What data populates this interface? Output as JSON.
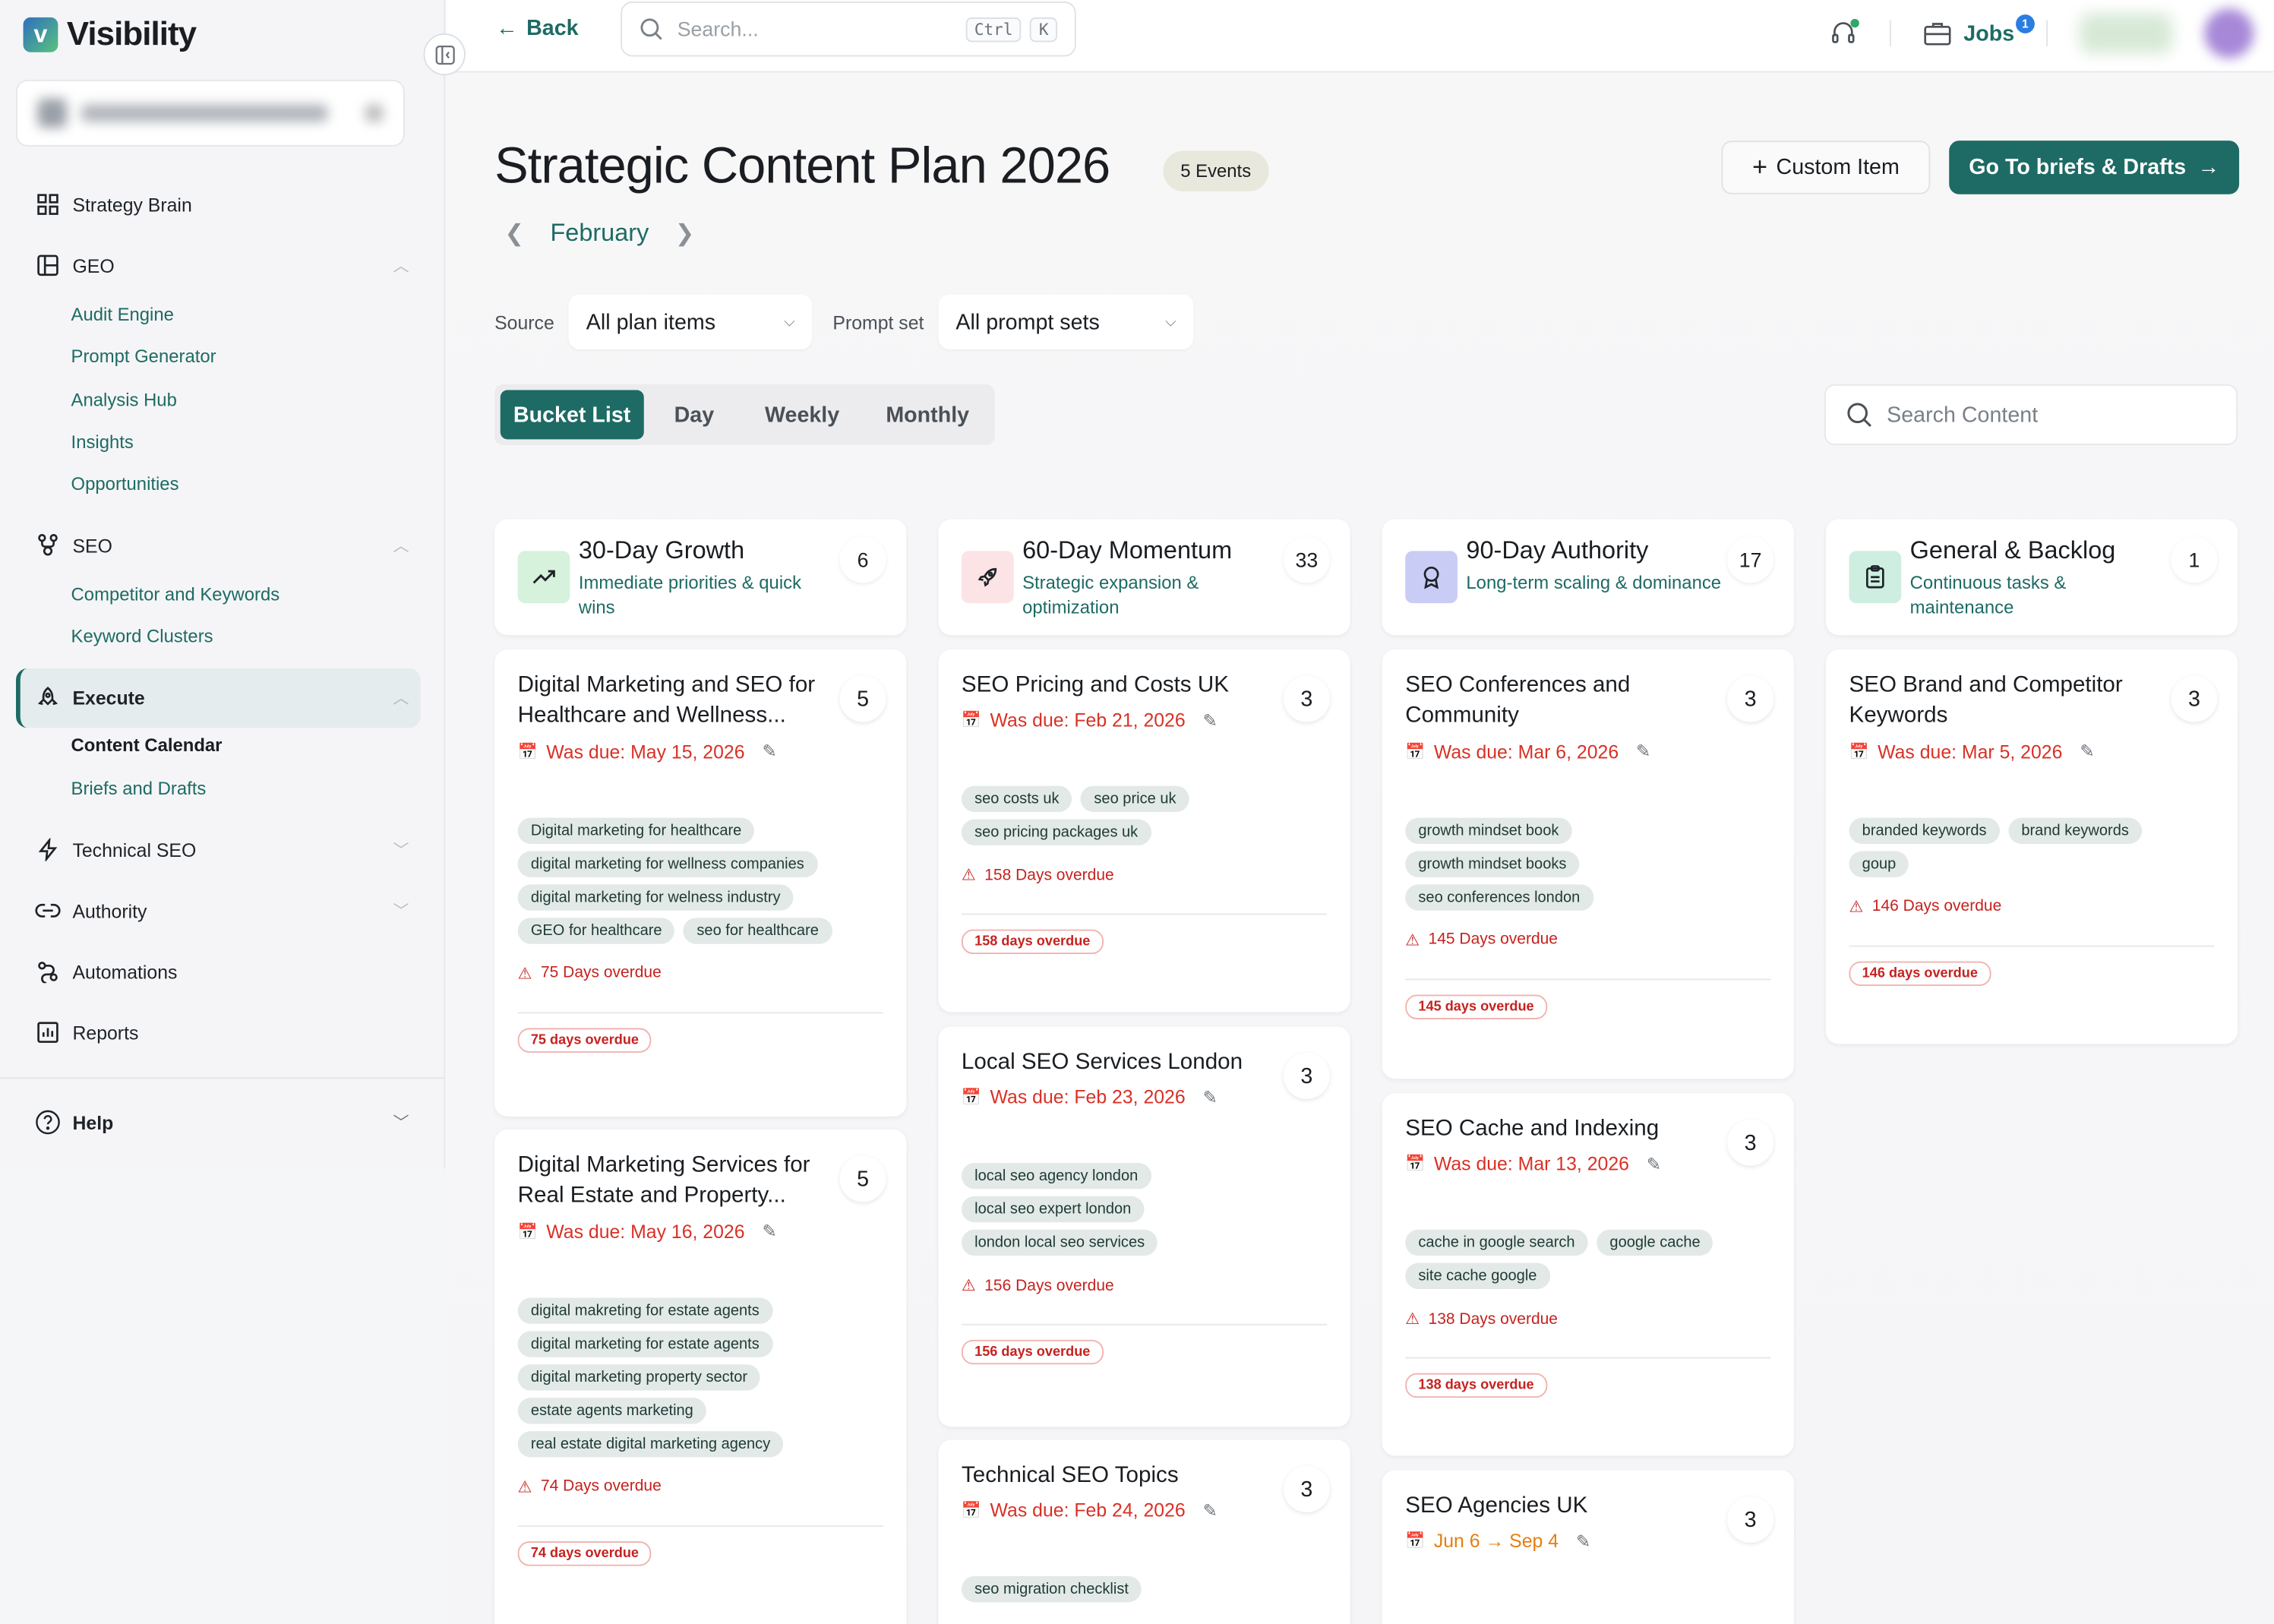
{
  "app": {
    "name": "Visibility",
    "logo_letter": "v"
  },
  "sidebar": {
    "items": [
      {
        "label": "Strategy Brain",
        "icon": "grid-icon"
      },
      {
        "label": "GEO",
        "icon": "layout-icon",
        "sub": [
          "Audit Engine",
          "Prompt Generator",
          "Analysis Hub",
          "Insights",
          "Opportunities"
        ]
      },
      {
        "label": "SEO",
        "icon": "network-icon",
        "sub": [
          "Competitor and Keywords",
          "Keyword Clusters"
        ]
      },
      {
        "label": "Execute",
        "icon": "rocket-icon",
        "sub": [
          "Content Calendar",
          "Briefs and Drafts"
        ]
      },
      {
        "label": "Technical SEO",
        "icon": "bolt-icon"
      },
      {
        "label": "Authority",
        "icon": "link-icon"
      },
      {
        "label": "Automations",
        "icon": "automation-icon"
      },
      {
        "label": "Reports",
        "icon": "chart-icon"
      }
    ],
    "help": "Help"
  },
  "topbar": {
    "back": "Back",
    "search_placeholder": "Search...",
    "kbd_1": "Ctrl",
    "kbd_2": "K",
    "jobs": "Jobs",
    "jobs_badge": "1"
  },
  "header": {
    "title": "Strategic Content Plan 2026",
    "events": "5 Events",
    "month": "February",
    "custom_item": "Custom Item",
    "go_button": "Go To briefs & Drafts"
  },
  "filters": {
    "source_label": "Source",
    "source_value": "All plan items",
    "prompt_label": "Prompt set",
    "prompt_value": "All prompt sets"
  },
  "view_tabs": [
    "Bucket List",
    "Day",
    "Weekly",
    "Monthly"
  ],
  "search_content_placeholder": "Search Content",
  "columns": [
    {
      "title": "30-Day Growth",
      "subtitle": "Immediate priorities & quick wins",
      "count": "6",
      "icon_color": "#d6f1dc"
    },
    {
      "title": "60-Day Momentum",
      "subtitle": "Strategic expansion & optimization",
      "count": "33",
      "icon_color": "#fbe3e6"
    },
    {
      "title": "90-Day Authority",
      "subtitle": "Long-term scaling & dominance",
      "count": "17",
      "icon_color": "#c9ccf5"
    },
    {
      "title": "General & Backlog",
      "subtitle": "Continuous tasks & maintenance",
      "count": "1",
      "icon_color": "#cdeee0"
    }
  ],
  "cards": [
    {
      "title": "Digital Marketing and SEO for Healthcare and Wellness...",
      "count": "5",
      "due": "Was due: May 15, 2026",
      "tags": [
        "Digital marketing for healthcare",
        "digital marketing for wellness companies",
        "digital marketing for welness industry",
        "GEO for healthcare",
        "seo for healthcare"
      ],
      "overdue": "75 Days overdue",
      "pill": "75 days overdue"
    },
    {
      "title": "Digital Marketing Services for Real Estate and Property...",
      "count": "5",
      "due": "Was due: May 16, 2026",
      "tags": [
        "digital makreting for estate agents",
        "digital marketing for estate agents",
        "digital marketing property sector",
        "estate agents marketing",
        "real estate digital marketing agency"
      ],
      "overdue": "74 Days overdue",
      "pill": "74 days overdue"
    },
    {
      "title": "SEO Pricing and Costs UK",
      "count": "3",
      "due": "Was due: Feb 21, 2026",
      "tags": [
        "seo costs uk",
        "seo price uk",
        "seo pricing packages uk"
      ],
      "overdue": "158 Days overdue",
      "pill": "158 days overdue"
    },
    {
      "title": "Local SEO Services London",
      "count": "3",
      "due": "Was due: Feb 23, 2026",
      "tags": [
        "local seo agency london",
        "local seo expert london",
        "london local seo services"
      ],
      "overdue": "156 Days overdue",
      "pill": "156 days overdue"
    },
    {
      "title": "Technical SEO Topics",
      "count": "3",
      "due": "Was due: Feb 24, 2026",
      "tags": [
        "seo migration checklist"
      ]
    },
    {
      "title": "SEO Conferences and Community",
      "count": "3",
      "due": "Was due: Mar 6, 2026",
      "tags": [
        "growth mindset book",
        "growth mindset books",
        "seo conferences london"
      ],
      "overdue": "145 Days overdue",
      "pill": "145 days overdue"
    },
    {
      "title": "SEO Cache and Indexing",
      "count": "3",
      "due": "Was due: Mar 13, 2026",
      "tags": [
        "cache in google search",
        "google cache",
        "site cache google"
      ],
      "overdue": "138 Days overdue",
      "pill": "138 days overdue"
    },
    {
      "title": "SEO Agencies UK",
      "count": "3",
      "due": "Jun 6 → Sep 4"
    },
    {
      "title": "SEO Brand and Competitor Keywords",
      "count": "3",
      "due": "Was due: Mar 5, 2026",
      "tags": [
        "branded keywords",
        "brand keywords",
        "goup"
      ],
      "overdue": "146 Days overdue",
      "pill": "146 days overdue"
    }
  ]
}
